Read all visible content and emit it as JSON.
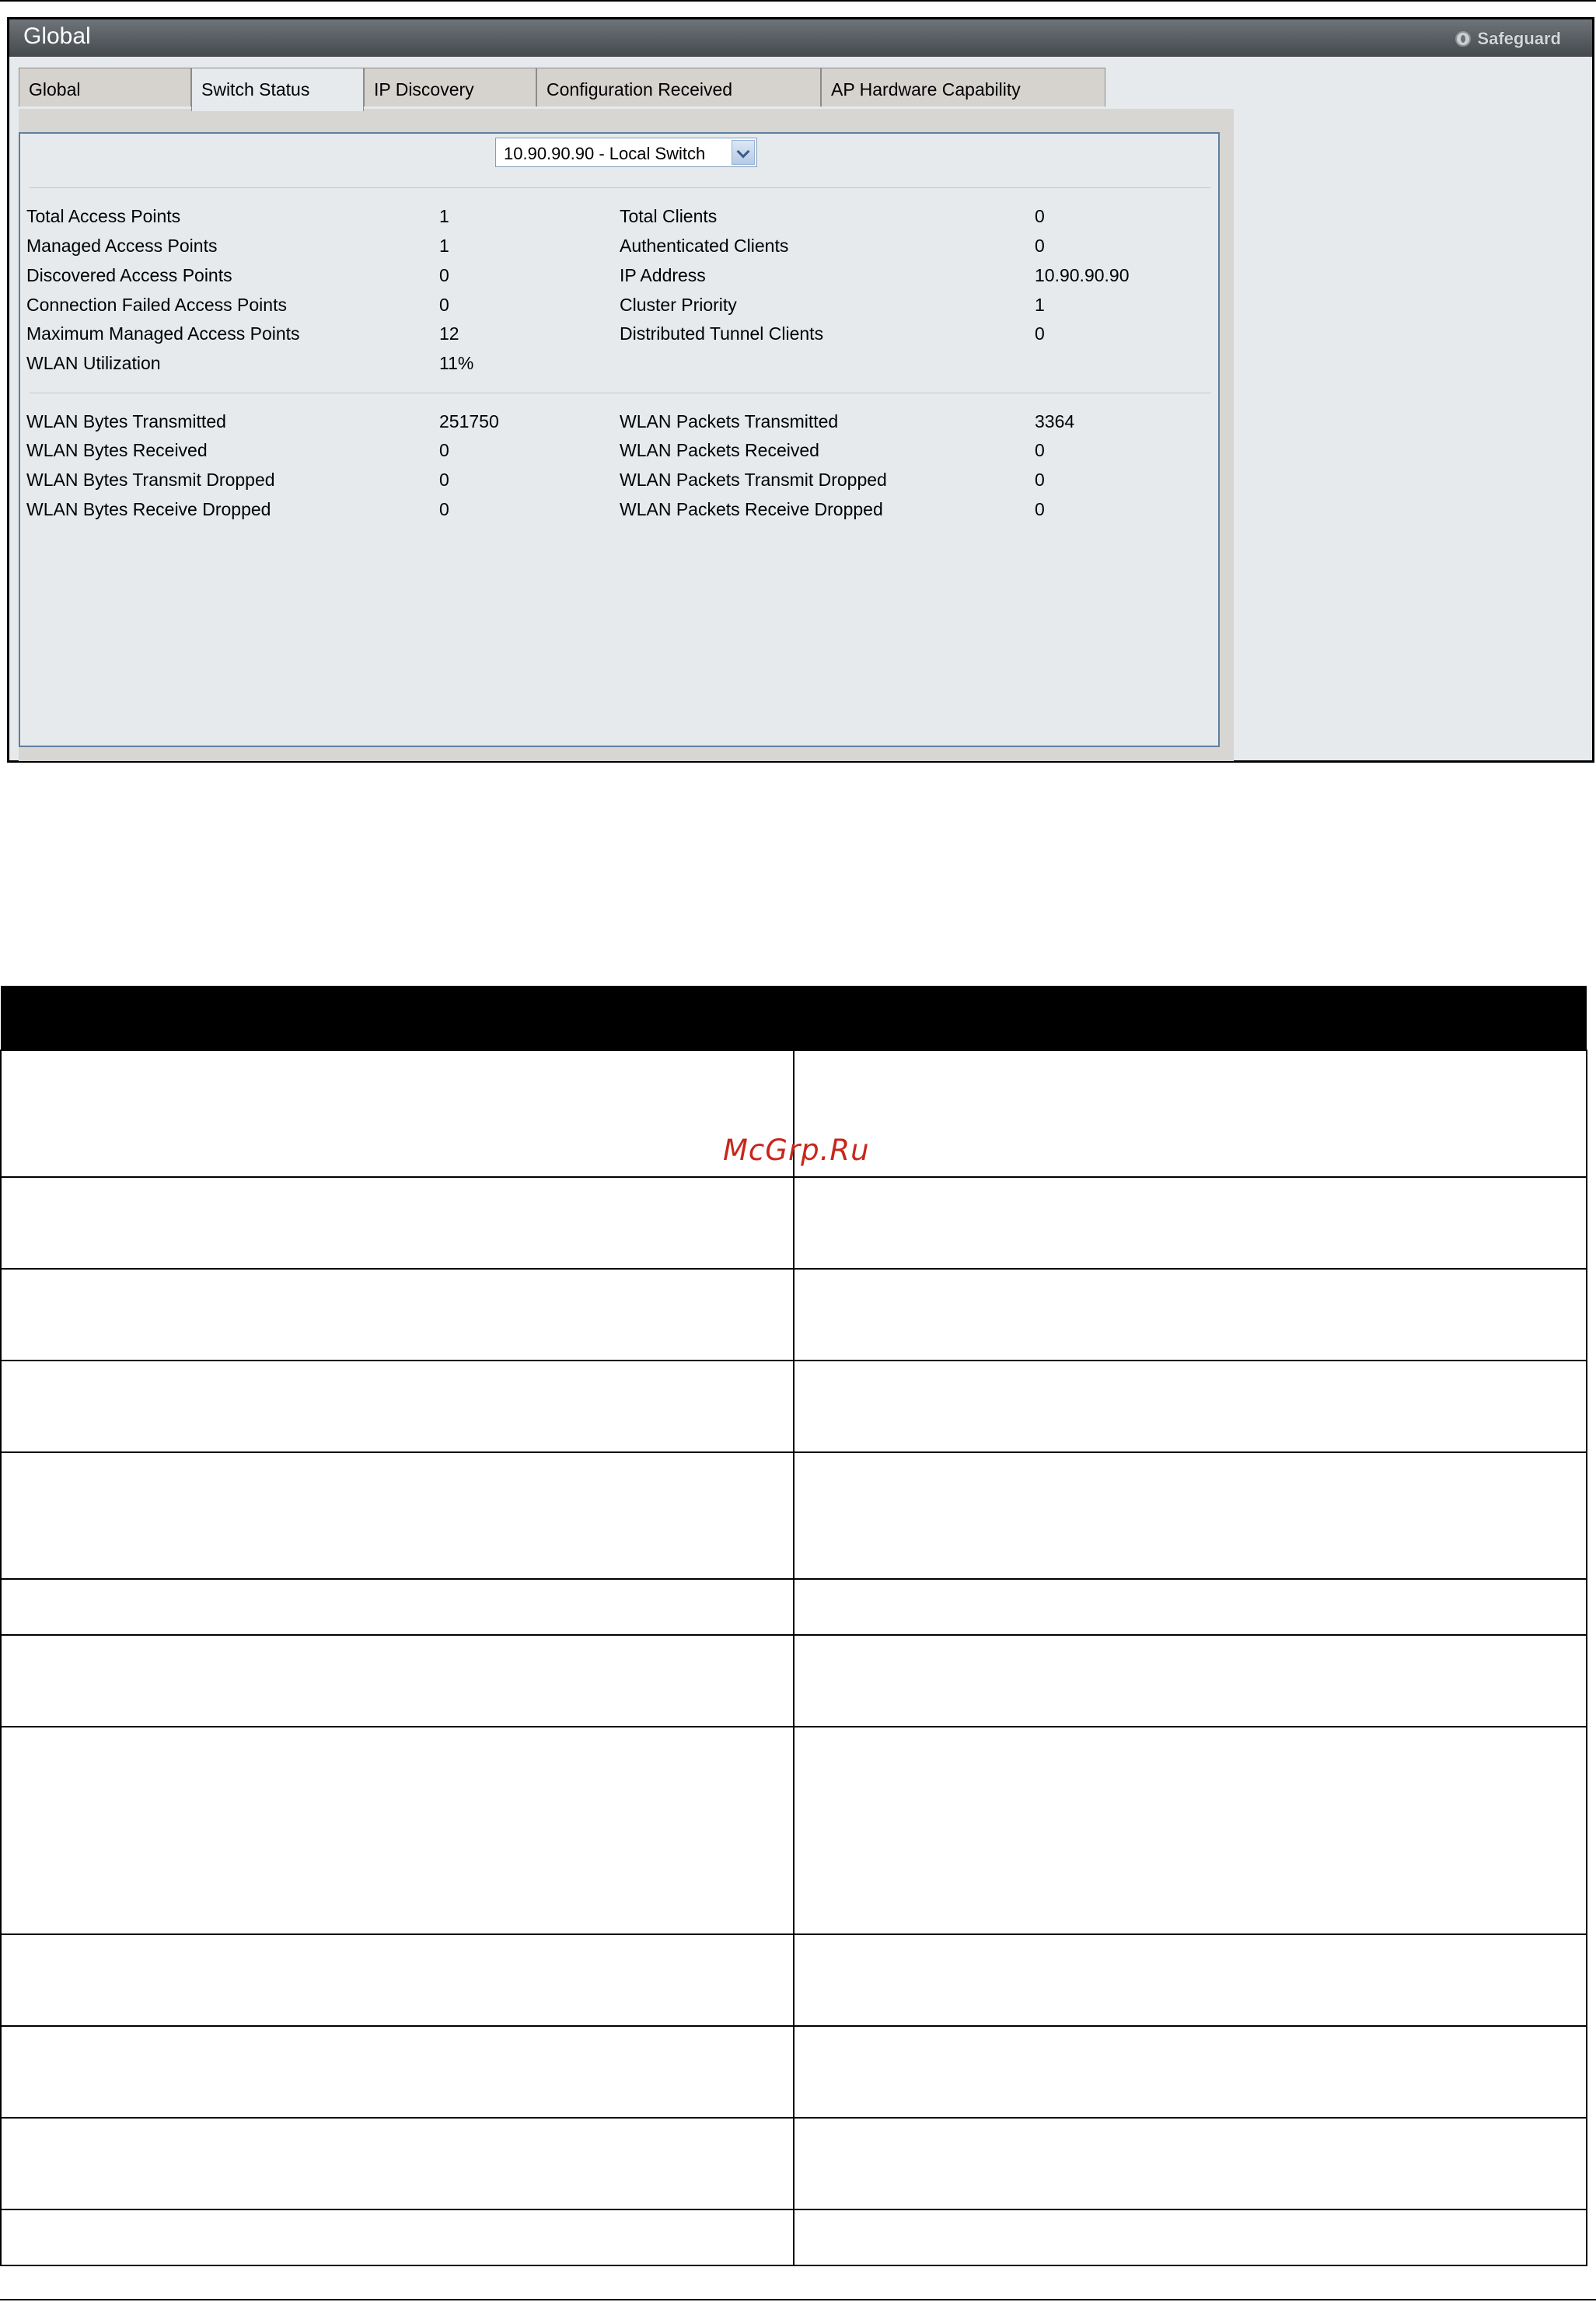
{
  "window": {
    "title": "Global",
    "safeguard_label": "Safeguard"
  },
  "tabs": [
    {
      "label": "Global",
      "active": false
    },
    {
      "label": "Switch Status",
      "active": true
    },
    {
      "label": "IP Discovery",
      "active": false
    },
    {
      "label": "Configuration Received",
      "active": false
    },
    {
      "label": "AP Hardware Capability",
      "active": false
    }
  ],
  "switch_select": {
    "value": "10.90.90.90 - Local Switch"
  },
  "status_left": [
    {
      "label": "Total Access Points",
      "value": "1"
    },
    {
      "label": "Managed Access Points",
      "value": "1"
    },
    {
      "label": "Discovered Access Points",
      "value": "0"
    },
    {
      "label": "Connection Failed Access Points",
      "value": "0"
    },
    {
      "label": "Maximum Managed Access Points",
      "value": "12"
    },
    {
      "label": "WLAN Utilization",
      "value": "11%"
    }
  ],
  "status_right": [
    {
      "label": "Total Clients",
      "value": "0"
    },
    {
      "label": "Authenticated Clients",
      "value": "0"
    },
    {
      "label": "IP Address",
      "value": "10.90.90.90"
    },
    {
      "label": "Cluster Priority",
      "value": "1"
    },
    {
      "label": "Distributed Tunnel Clients",
      "value": "0"
    }
  ],
  "traffic_left": [
    {
      "label": "WLAN Bytes Transmitted",
      "value": "251750"
    },
    {
      "label": "WLAN Bytes Received",
      "value": "0"
    },
    {
      "label": "WLAN Bytes Transmit Dropped",
      "value": "0"
    },
    {
      "label": "WLAN Bytes Receive Dropped",
      "value": "0"
    }
  ],
  "traffic_right": [
    {
      "label": "WLAN Packets Transmitted",
      "value": "3364"
    },
    {
      "label": "WLAN Packets Received",
      "value": "0"
    },
    {
      "label": "WLAN Packets Transmit Dropped",
      "value": "0"
    },
    {
      "label": "WLAN Packets Receive Dropped",
      "value": "0"
    }
  ],
  "watermark": "McGrp.Ru"
}
